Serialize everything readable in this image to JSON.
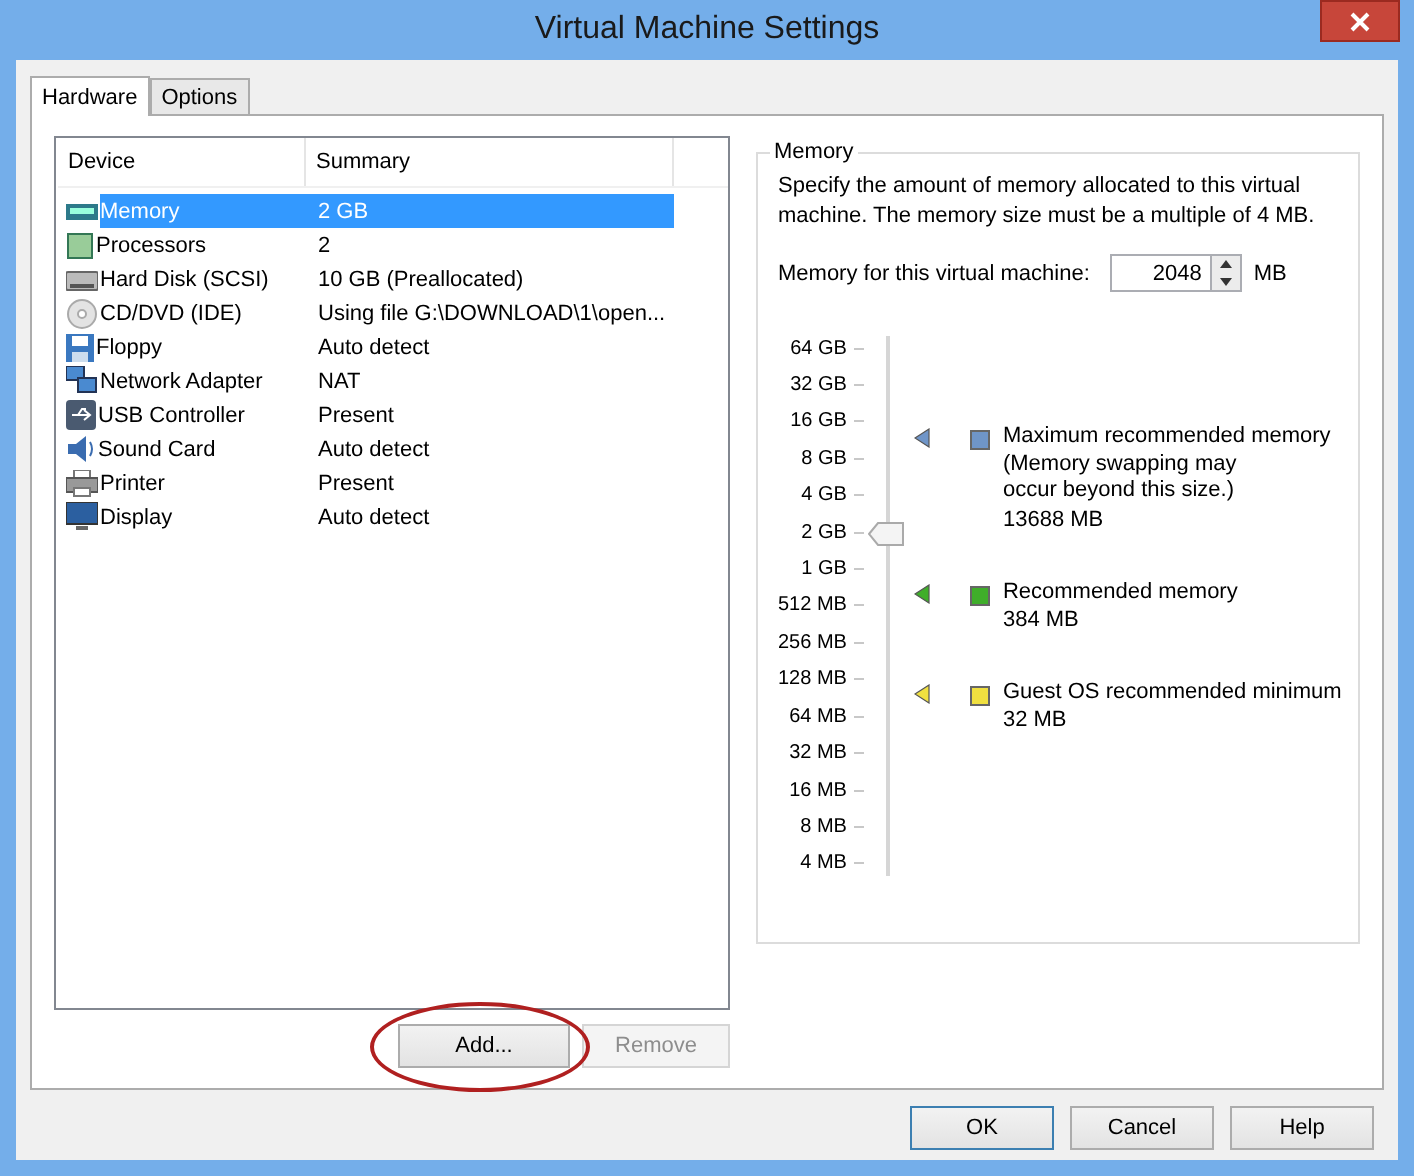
{
  "window": {
    "title": "Virtual Machine Settings"
  },
  "tabs": [
    {
      "label": "Hardware",
      "selected": true
    },
    {
      "label": "Options",
      "selected": false
    }
  ],
  "device_table": {
    "columns": [
      "Device",
      "Summary"
    ],
    "rows": [
      {
        "kind": "memory",
        "device": "Memory",
        "summary": "2 GB",
        "selected": true
      },
      {
        "kind": "cpu",
        "device": "Processors",
        "summary": "2",
        "selected": false
      },
      {
        "kind": "disk",
        "device": "Hard Disk (SCSI)",
        "summary": "10 GB (Preallocated)",
        "selected": false
      },
      {
        "kind": "cd",
        "device": "CD/DVD (IDE)",
        "summary": "Using file G:\\DOWNLOAD\\1\\open...",
        "selected": false
      },
      {
        "kind": "floppy",
        "device": "Floppy",
        "summary": "Auto detect",
        "selected": false
      },
      {
        "kind": "network",
        "device": "Network Adapter",
        "summary": "NAT",
        "selected": false
      },
      {
        "kind": "usb",
        "device": "USB Controller",
        "summary": "Present",
        "selected": false
      },
      {
        "kind": "sound",
        "device": "Sound Card",
        "summary": "Auto detect",
        "selected": false
      },
      {
        "kind": "printer",
        "device": "Printer",
        "summary": "Present",
        "selected": false
      },
      {
        "kind": "display",
        "device": "Display",
        "summary": "Auto detect",
        "selected": false
      }
    ]
  },
  "list_buttons": [
    {
      "label": "Add...",
      "disabled": false
    },
    {
      "label": "Remove",
      "disabled": true
    }
  ],
  "memory": {
    "group_title": "Memory",
    "description": "Specify the amount of memory allocated to this virtual machine. The memory size must be a multiple of 4 MB.",
    "field_label": "Memory for this virtual machine:",
    "value": "2048",
    "unit": "MB",
    "slider": {
      "level": 0.643,
      "ticks": [
        "64 GB",
        "32 GB",
        "16 GB",
        "8 GB",
        "4 GB",
        "2 GB",
        "1 GB",
        "512 MB",
        "256 MB",
        "128 MB",
        "64 MB",
        "32 MB",
        "16 MB",
        "8 MB",
        "4 MB"
      ]
    },
    "markers": [
      {
        "label": "Maximum recommended memory",
        "note": "(Memory swapping may occur beyond this size.)",
        "value": "13688 MB",
        "color": "#6f95c8"
      },
      {
        "label": "Recommended memory",
        "value": "384 MB",
        "color": "#3fae2a"
      },
      {
        "label": "Guest OS recommended minimum",
        "value": "32 MB",
        "color": "#f0e040"
      }
    ]
  },
  "footer_buttons": [
    {
      "label": "OK",
      "selected": true
    },
    {
      "label": "Cancel",
      "selected": false
    },
    {
      "label": "Help",
      "selected": false
    }
  ]
}
